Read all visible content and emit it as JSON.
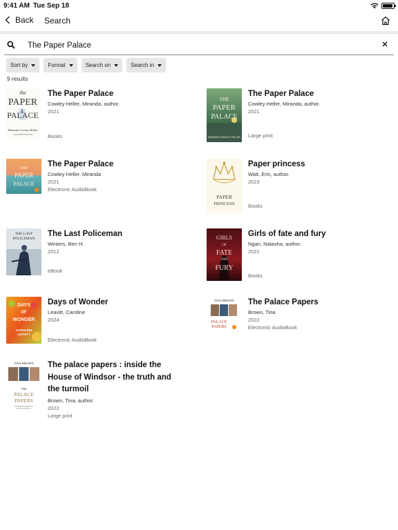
{
  "status": {
    "time": "9:41 AM",
    "date": "Tue Sep 18"
  },
  "nav": {
    "back_label": "Back",
    "title": "Search"
  },
  "search": {
    "query": "The Paper Palace"
  },
  "filters": [
    "Sort by",
    "Format",
    "Search on",
    "Search in"
  ],
  "results_count": "9 results",
  "results": [
    {
      "title": "The Paper Palace",
      "author": "Cowley Heller, Miranda, author.",
      "year": "2021",
      "format": "Books",
      "cover_text": [
        "the",
        "PAPER",
        "PALACE",
        "Miranda Cowley Heller"
      ]
    },
    {
      "title": "The Paper Palace",
      "author": "Cowley Heller, Miranda, author.",
      "year": "2021",
      "format": "Large print",
      "cover_text": [
        "THE",
        "PAPER",
        "PALACE",
        "MIRANDA COWLEY HELLER"
      ]
    },
    {
      "title": "The Paper Palace",
      "author": "Cowley Heller, Miranda",
      "year": "2021",
      "format": "Electronic AudioBook",
      "cover_text": [
        "THE",
        "PAPER",
        "PALACE"
      ]
    },
    {
      "title": "Paper princess",
      "author": "Watt, Erin, author.",
      "year": "2023",
      "format": "Books",
      "cover_text": [
        "PAPER",
        "PRINCESS"
      ]
    },
    {
      "title": "The Last Policeman",
      "author": "Winters, Ben H.",
      "year": "2012",
      "format": "eBook",
      "cover_text": [
        "THE LAST",
        "POLICEMAN"
      ]
    },
    {
      "title": "Girls of fate and fury",
      "author": "Ngan, Natasha, author.",
      "year": "2021",
      "format": "Books",
      "cover_text": [
        "GIRLS",
        "OF",
        "FATE",
        "AND",
        "FURY"
      ]
    },
    {
      "title": "Days of Wonder",
      "author": "Leavitt, Caroline",
      "year": "2024",
      "format": "Electronic AudioBook",
      "cover_text": [
        "DAYS",
        "OF",
        "WONDER",
        "CAROLINE",
        "LEAVITT"
      ]
    },
    {
      "title": "The Palace Papers",
      "author": "Brown, Tina",
      "year": "2022",
      "format": "Electronic AudioBook",
      "cover_text": [
        "TINA BROWN",
        "PALACE",
        "PAPERS"
      ]
    },
    {
      "title": "The palace papers : inside the House of Windsor - the truth and the turmoil",
      "author": "Brown, Tina, author.",
      "year": "2022",
      "format": "Large print",
      "cover_text": [
        "TINA BROWN",
        "THE",
        "PALACE",
        "PAPERS"
      ]
    }
  ],
  "colors": {
    "filter_bg": "#e6e6e6",
    "text": "#111111",
    "muted": "#666666"
  },
  "icons": [
    "chevron-left-icon",
    "home-icon",
    "search-icon",
    "close-icon",
    "caret-down-icon",
    "wifi-icon",
    "battery-icon"
  ]
}
